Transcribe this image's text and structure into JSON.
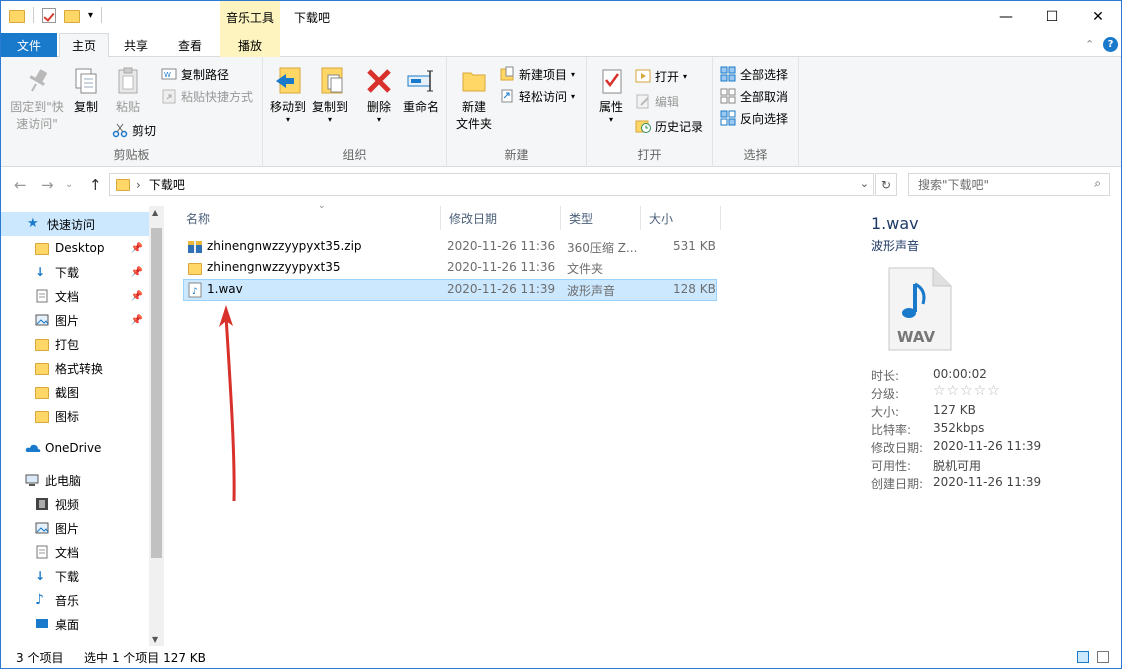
{
  "window": {
    "title": "下载吧",
    "context_tab": "音乐工具",
    "controls": {
      "minimize": "—",
      "maximize": "☐",
      "close": "✕"
    }
  },
  "ribbon_tabs": [
    "文件",
    "主页",
    "共享",
    "查看",
    "播放"
  ],
  "ribbon": {
    "clipboard": {
      "label": "剪贴板",
      "pin_quick": "固定到\"快速访问\"",
      "pin_quick_l1": "固定到\"快",
      "pin_quick_l2": "速访问\"",
      "copy": "复制",
      "paste": "粘贴",
      "copy_path": "复制路径",
      "paste_shortcut": "粘贴快捷方式",
      "cut": "剪切"
    },
    "organize": {
      "label": "组织",
      "move_to": "移动到",
      "copy_to": "复制到",
      "delete": "删除",
      "rename": "重命名"
    },
    "new": {
      "label": "新建",
      "new_folder_l1": "新建",
      "new_folder_l2": "文件夹",
      "new_item": "新建项目",
      "easy_access": "轻松访问"
    },
    "open": {
      "label": "打开",
      "properties": "属性",
      "open": "打开",
      "edit": "编辑",
      "history": "历史记录"
    },
    "select": {
      "label": "选择",
      "select_all": "全部选择",
      "select_none": "全部取消",
      "invert": "反向选择"
    }
  },
  "address": {
    "path": "下载吧",
    "search_placeholder": "搜索\"下载吧\""
  },
  "nav_pane": {
    "quick_access": "快速访问",
    "quick_items": [
      "Desktop",
      "下载",
      "文档",
      "图片",
      "打包",
      "格式转换",
      "截图",
      "图标"
    ],
    "onedrive": "OneDrive",
    "this_pc": "此电脑",
    "pc_items": [
      "视频",
      "图片",
      "文档",
      "下载",
      "音乐",
      "桌面"
    ]
  },
  "file_list": {
    "columns": [
      "名称",
      "修改日期",
      "类型",
      "大小"
    ],
    "rows": [
      {
        "name": "zhinengnwzzyypyxt35.zip",
        "date": "2020-11-26 11:36",
        "type": "360压缩 Z...",
        "size": "531 KB"
      },
      {
        "name": "zhinengnwzzyypyxt35",
        "date": "2020-11-26 11:36",
        "type": "文件夹",
        "size": ""
      },
      {
        "name": "1.wav",
        "date": "2020-11-26 11:39",
        "type": "波形声音",
        "size": "128 KB"
      }
    ]
  },
  "details": {
    "filename": "1.wav",
    "filetype": "波形声音",
    "icon_text": "WAV",
    "props": [
      {
        "key": "时长:",
        "val": "00:00:02"
      },
      {
        "key": "分级:",
        "val": "☆☆☆☆☆"
      },
      {
        "key": "大小:",
        "val": "127 KB"
      },
      {
        "key": "比特率:",
        "val": "352kbps"
      },
      {
        "key": "修改日期:",
        "val": "2020-11-26 11:39"
      },
      {
        "key": "可用性:",
        "val": "脱机可用"
      },
      {
        "key": "创建日期:",
        "val": "2020-11-26 11:39"
      }
    ]
  },
  "status": {
    "count": "3 个项目",
    "selection": "选中 1 个项目  127 KB"
  },
  "colors": {
    "accent": "#1979ca",
    "selection": "#cce8ff",
    "context_tab": "#fdf4bf",
    "arrow": "#d8312b"
  }
}
